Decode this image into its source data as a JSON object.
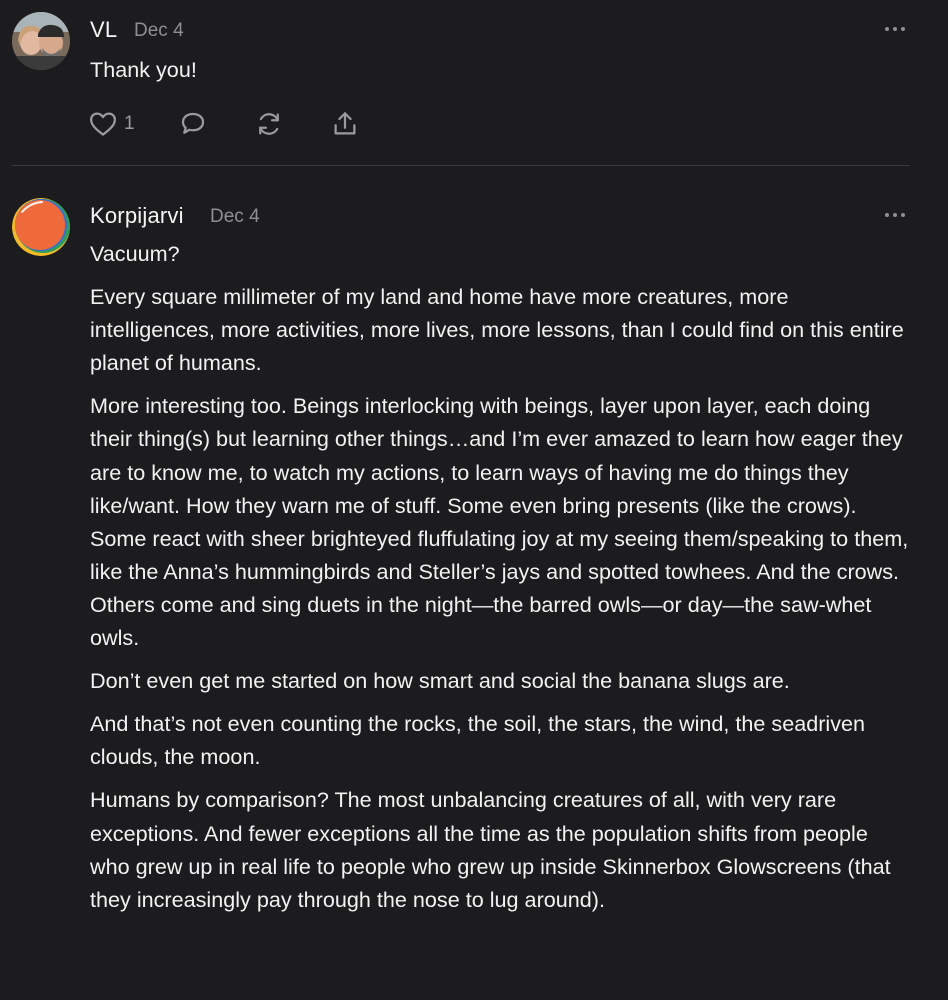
{
  "comments": [
    {
      "author": "VL",
      "date": "Dec 4",
      "paragraphs": [
        "Thank you!"
      ],
      "likes": "1",
      "avatar_icon": "couple-photo-avatar",
      "actions": [
        "heart-icon",
        "comment-icon",
        "restack-icon",
        "share-icon"
      ]
    },
    {
      "author": "Korpijarvi",
      "date": "Dec 4",
      "avatar_icon": "orange-circle-avatar",
      "paragraphs": [
        "Vacuum?",
        "Every square millimeter of my land and home have more creatures, more intelligences, more activities, more lives, more lessons, than I could find on this entire planet of humans.",
        "More interesting too. Beings interlocking with beings, layer upon layer, each doing their thing(s) but learning other things…and I’m ever amazed to learn how eager they are to know me, to watch my actions, to learn ways of having me do things they like/want. How they warn me of stuff. Some even bring presents (like the crows). Some react with sheer brighteyed fluffulating joy at my seeing them/speaking to them, like the Anna’s hummingbirds and Steller’s jays and spotted towhees. And the crows. Others come and sing duets in the night—the barred owls—or day—the saw-whet owls.",
        "Don’t even get me started on how smart and social the banana slugs are.",
        "And that’s not even counting the rocks, the soil, the stars, the wind, the seadriven clouds, the moon.",
        "Humans by comparison? The most unbalancing creatures of all, with very rare exceptions. And fewer exceptions all the time as the population shifts from people who grew up in real life to people who grew up inside Skinnerbox Glowscreens (that they increasingly pay through the nose to lug around)."
      ]
    }
  ],
  "colors": {
    "background": "#1c1c1e",
    "text": "#f2f2f2",
    "muted": "#8e8e93",
    "divider": "#3a3a3c",
    "avatar_orange": "#f26b3a"
  }
}
